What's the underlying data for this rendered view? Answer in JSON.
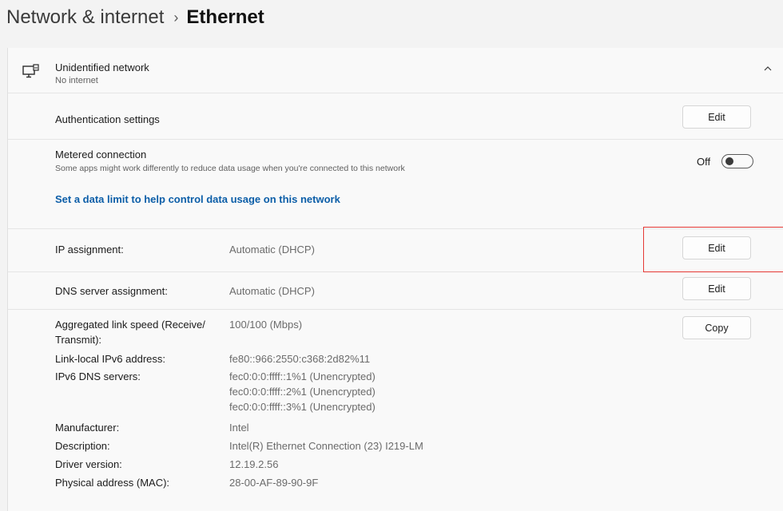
{
  "breadcrumb": {
    "parent": "Network & internet",
    "separator": "›",
    "current": "Ethernet"
  },
  "network": {
    "name": "Unidentified network",
    "status": "No internet",
    "icon": "ethernet-monitor-icon",
    "expand_icon": "chevron-up-icon"
  },
  "auth": {
    "label": "Authentication settings",
    "button": "Edit"
  },
  "metered": {
    "title": "Metered connection",
    "description": "Some apps might work differently to reduce data usage when you're connected to this network",
    "toggle_state": "Off",
    "link": "Set a data limit to help control data usage on this network"
  },
  "ip": {
    "label": "IP assignment:",
    "value": "Automatic (DHCP)",
    "button": "Edit"
  },
  "dns": {
    "label": "DNS server assignment:",
    "value": "Automatic (DHCP)",
    "button": "Edit"
  },
  "properties": {
    "copy_button": "Copy",
    "link_speed_label_1": "Aggregated link speed (Receive/",
    "link_speed_label_2": "Transmit):",
    "link_speed_value": "100/100 (Mbps)",
    "ipv6_label": "Link-local IPv6 address:",
    "ipv6_value": "fe80::966:2550:c368:2d82%11",
    "dns6_label": "IPv6 DNS servers:",
    "dns6_values": [
      "fec0:0:0:ffff::1%1 (Unencrypted)",
      "fec0:0:0:ffff::2%1 (Unencrypted)",
      "fec0:0:0:ffff::3%1 (Unencrypted)"
    ],
    "manufacturer_label": "Manufacturer:",
    "manufacturer_value": "Intel",
    "description_label": "Description:",
    "description_value": "Intel(R) Ethernet Connection (23) I219-LM",
    "driver_label": "Driver version:",
    "driver_value": "12.19.2.56",
    "mac_label": "Physical address (MAC):",
    "mac_value": "28-00-AF-89-90-9F"
  },
  "colors": {
    "link": "#0c5ea8",
    "highlight": "#e53935"
  }
}
